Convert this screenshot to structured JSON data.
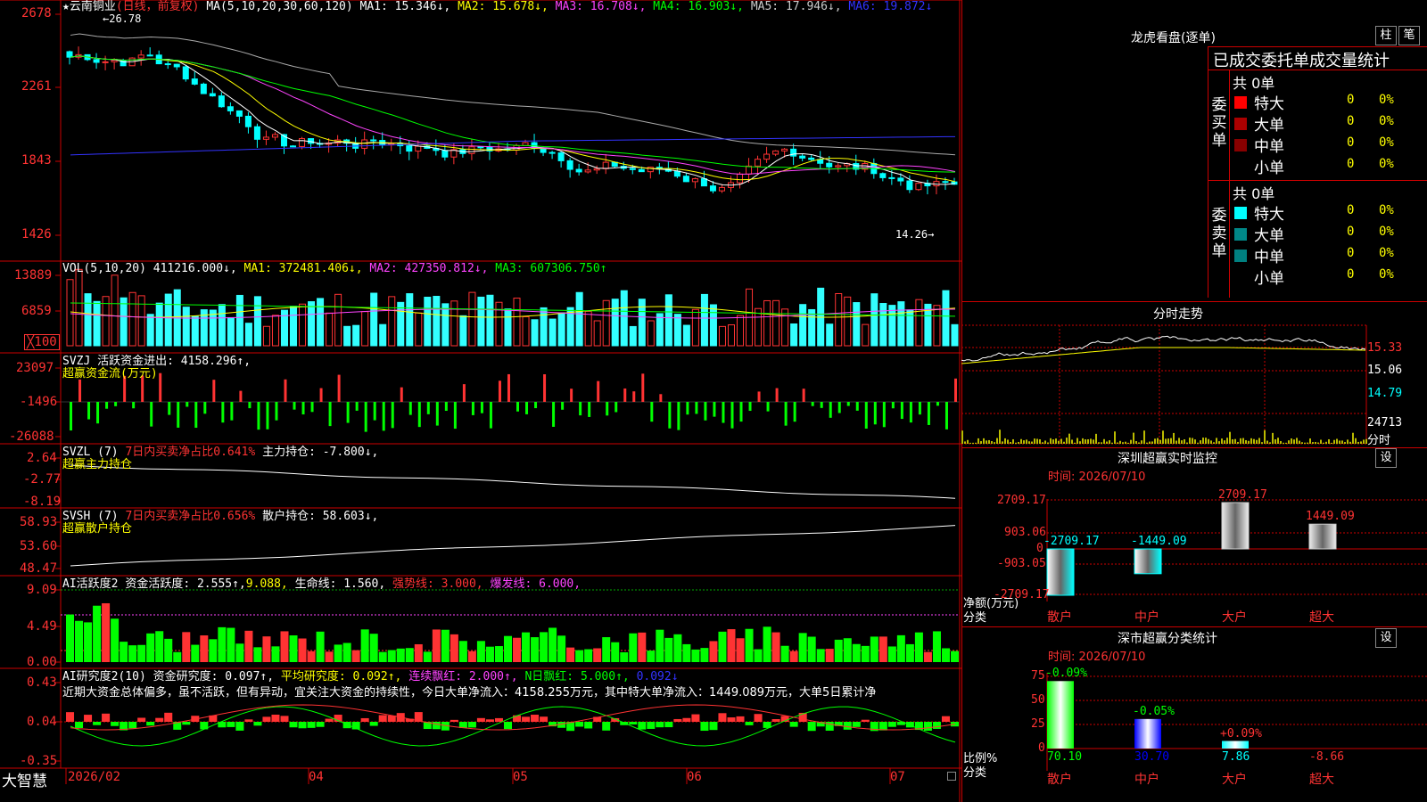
{
  "colors": {
    "up": "#ff3333",
    "down": "#00ffff",
    "vol_down": "#33ffff",
    "bg": "#000000",
    "grid": "#cc0000",
    "yellow": "#ffff00",
    "magenta": "#ff44ff",
    "green": "#00ff00",
    "white": "#ffffff",
    "gray": "#aaaaaa",
    "blue": "#3333ff"
  },
  "main": {
    "stock_name": "★云南铜业",
    "period": "(日线，前复权)",
    "ma_label": "MA(5,10,20,30,60,120)",
    "ma1": "MA1: 15.346↓,",
    "ma2": "MA2: 15.678↓,",
    "ma3": "MA3: 16.708↓,",
    "ma4": "MA4: 16.903↓,",
    "ma5": "MA5: 17.946↓,",
    "ma6": "MA6: 19.872↓",
    "axis": [
      "2678",
      "2261",
      "1843",
      "1426"
    ],
    "high_label": "←26.78",
    "low_label": "14.26→"
  },
  "vol": {
    "label": "VOL(5,10,20)",
    "value": "411216.000↓,",
    "ma1": "MA1: 372481.406↓,",
    "ma2": "MA2: 427350.812↓,",
    "ma3": "MA3: 607306.750↑",
    "axis": [
      "13889",
      "6859"
    ],
    "unit": "╳100"
  },
  "svzj": {
    "label": "SVZJ",
    "title": "活跃资金进出: 4158.296↑,",
    "sub": "超赢资金流(万元)",
    "axis": [
      "23097",
      "-1496",
      "-26088"
    ]
  },
  "svzl": {
    "label": "SVZL (7)",
    "ratio": "7日内买卖净占比0.641%",
    "hold": "主力持仓: -7.800↓,",
    "sub": "超赢主力持仓",
    "axis": [
      "2.64",
      "-2.77",
      "-8.19"
    ]
  },
  "svsh": {
    "label": "SVSH (7)",
    "ratio": "7日内买卖净占比0.656%",
    "hold": "散户持仓: 58.603↓,",
    "sub": "超赢散户持仓",
    "axis": [
      "58.93",
      "53.60",
      "48.47"
    ]
  },
  "ai_act": {
    "label": "AI活跃度2",
    "act": "资金活跃度: 2.555↑,",
    "v2": "9.088,",
    "life": "生命线: 1.560,",
    "strong": "强势线: 3.000,",
    "burst": "爆发线: 6.000,",
    "axis": [
      "9.09",
      "4.49",
      "0.00"
    ]
  },
  "ai_res": {
    "label": "AI研究度2(10)",
    "res": "资金研究度: 0.097↑,",
    "avg": "平均研究度: 0.092↑,",
    "cont": "连续飘红: 2.000↑,",
    "nday": "N日飘红: 5.000↑,",
    "v5": "0.092↓",
    "commentary": "近期大资金总体偏多，虽不活跃，但有异动，宜关注大资金的持续性，今日大单净流入：4158.255万元，其中特大单净流入：1449.089万元，大单5日累计净",
    "axis": [
      "0.43",
      "0.04",
      "-0.35"
    ]
  },
  "xaxis": {
    "brand": "大智慧",
    "labels": [
      "2026/02",
      "04",
      "05",
      "06",
      "07"
    ]
  },
  "right": {
    "lhb_title": "龙虎看盘(逐单)",
    "btn1": "柱",
    "btn2": "笔",
    "order_title": "已成交委托单成交量统计",
    "buy_label": "委买单",
    "sell_label": "委卖单",
    "buy_total": "共 0单",
    "sell_total": "共 0单",
    "buy_rows": [
      {
        "name": "特大",
        "v": "0",
        "p": "0%",
        "color": "#ff0000"
      },
      {
        "name": "大单",
        "v": "0",
        "p": "0%",
        "color": "#aa0000"
      },
      {
        "name": "中单",
        "v": "0",
        "p": "0%",
        "color": "#880000"
      },
      {
        "name": "小单",
        "v": "0",
        "p": "0%",
        "color": "#000000"
      }
    ],
    "sell_rows": [
      {
        "name": "特大",
        "v": "0",
        "p": "0%",
        "color": "#00ffff"
      },
      {
        "name": "大单",
        "v": "0",
        "p": "0%",
        "color": "#008888"
      },
      {
        "name": "中单",
        "v": "0",
        "p": "0%",
        "color": "#008080"
      },
      {
        "name": "小单",
        "v": "0",
        "p": "0%",
        "color": "#000000"
      }
    ],
    "intraday_title": "分时走势",
    "intraday_axis": [
      "15.33",
      "15.06",
      "14.79",
      "24713"
    ],
    "intraday_unit": "分时",
    "sz_monitor_title": "深圳超赢实时监控",
    "sz_monitor_btn": "设",
    "sz_monitor_time": "时间: 2026/07/10",
    "sz_axis": [
      "2709.17",
      "903.06",
      "0",
      "-903.05",
      "-2709.17"
    ],
    "sz_unit1": "净额(万元)",
    "sz_unit2": "分类",
    "sz_bars": [
      {
        "cat": "散户",
        "value": -2709.17,
        "label": "-2709.17"
      },
      {
        "cat": "中户",
        "value": -1449.09,
        "label": "-1449.09"
      },
      {
        "cat": "大户",
        "value": 2709.17,
        "label": "2709.17"
      },
      {
        "cat": "超大",
        "value": 1449.09,
        "label": "1449.09"
      }
    ],
    "sz_class_title": "深市超赢分类统计",
    "sz_class_btn": "设",
    "sz_class_time": "时间: 2026/07/10",
    "cls_axis": [
      "75",
      "50",
      "25",
      "0"
    ],
    "cls_unit1": "比例%",
    "cls_unit2": "分类",
    "cls_bars": [
      {
        "cat": "散户",
        "value": 70.1,
        "label": "70.10",
        "delta": "-0.09%"
      },
      {
        "cat": "中户",
        "value": 30.7,
        "label": "30.70",
        "delta": "-0.05%"
      },
      {
        "cat": "大户",
        "value": 7.86,
        "label": "7.86",
        "delta": "+0.09%"
      },
      {
        "cat": "超大",
        "value": -8.66,
        "label": "-8.66",
        "delta": ""
      }
    ]
  }
}
